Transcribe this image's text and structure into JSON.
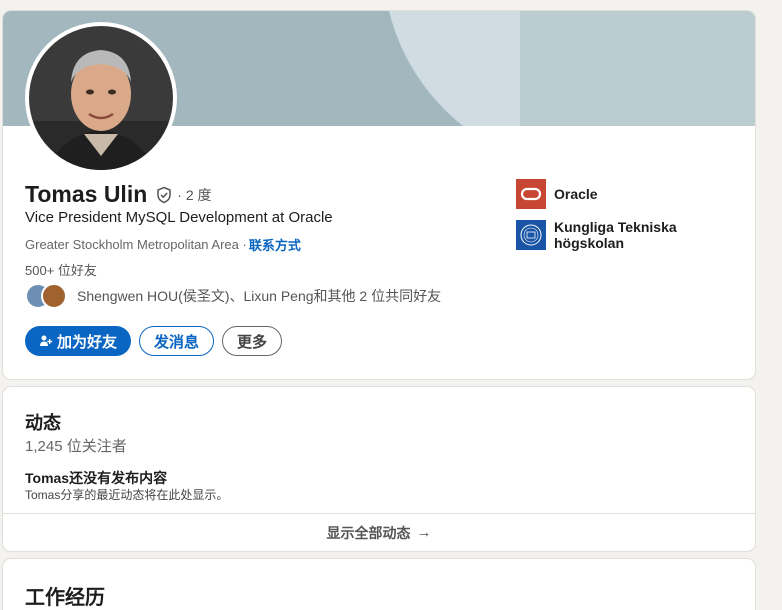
{
  "profile": {
    "name": "Tomas Ulin",
    "degree": "· 2 度",
    "headline": "Vice President MySQL Development at Oracle",
    "location": "Greater Stockholm Metropolitan Area ·",
    "contact_link": "联系方式",
    "connections": "500+ 位好友",
    "mutual_text": "Shengwen HOU(侯圣文)、Lixun Peng和其他 2 位共同好友",
    "buttons": {
      "connect": "加为好友",
      "message": "发消息",
      "more": "更多"
    },
    "companies": [
      {
        "name": "Oracle",
        "logo": "oracle-logo",
        "color": "#c74634"
      },
      {
        "name": "Kungliga Tekniska högskolan",
        "logo": "kth-logo",
        "color": "#1954a6"
      }
    ]
  },
  "activity": {
    "title": "动态",
    "followers": "1,245 位关注者",
    "empty_title": "Tomas还没有发布内容",
    "empty_desc": "Tomas分享的最近动态将在此处显示。",
    "show_all": "显示全部动态",
    "arrow": "→"
  },
  "experience": {
    "title": "工作经历"
  },
  "colors": {
    "accent": "#0a66c2",
    "background": "#f3f2ef"
  }
}
